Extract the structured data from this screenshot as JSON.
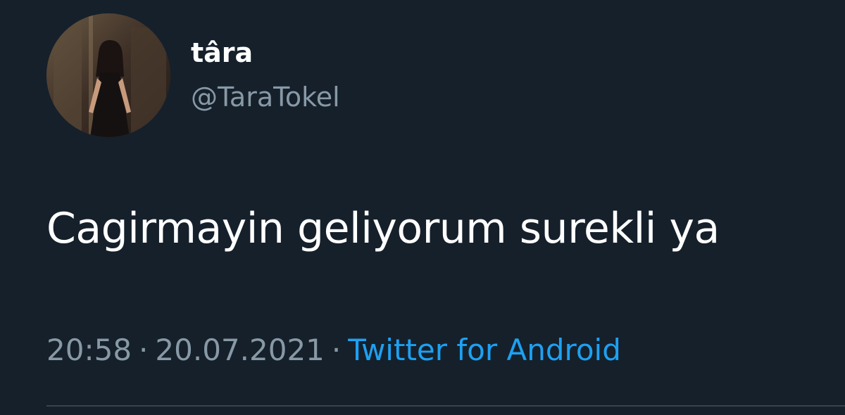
{
  "author": {
    "display_name": "târa",
    "handle": "@TaraTokel",
    "avatar": "profile-photo-avatar"
  },
  "tweet": {
    "text": "Cagirmayin geliyorum surekli ya"
  },
  "meta": {
    "time": "20:58",
    "date": "20.07.2021",
    "separator": "·",
    "source": "Twitter for Android"
  },
  "colors": {
    "background": "#15202b",
    "text_primary": "#ffffff",
    "text_secondary": "#8899a6",
    "link": "#1da1f2",
    "divider": "#38444d"
  }
}
